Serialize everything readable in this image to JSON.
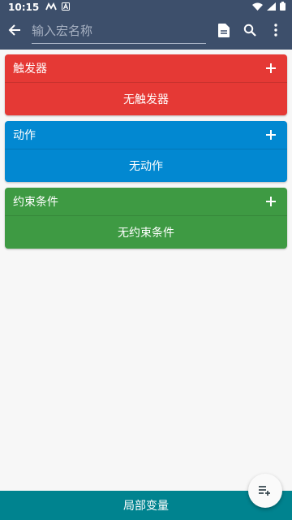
{
  "status_bar": {
    "time": "10:15",
    "icons": [
      "m-logo-icon",
      "a-logo-icon",
      "wifi-icon",
      "signal-icon",
      "battery-icon"
    ]
  },
  "toolbar": {
    "back_icon": "arrow-left-icon",
    "name_placeholder": "输入宏名称",
    "name_value": "",
    "actions": [
      "document-icon",
      "search-icon",
      "more-vertical-icon"
    ]
  },
  "sections": [
    {
      "title": "触发器",
      "empty_text": "无触发器",
      "color": "#e53935",
      "add_icon": "plus-icon"
    },
    {
      "title": "动作",
      "empty_text": "无动作",
      "color": "#0288d1",
      "add_icon": "plus-icon"
    },
    {
      "title": "约束条件",
      "empty_text": "无约束条件",
      "color": "#3e9a43",
      "add_icon": "plus-icon"
    }
  ],
  "footer": {
    "label": "局部变量",
    "color": "#00838f"
  },
  "fab": {
    "icon": "playlist-add-icon"
  }
}
